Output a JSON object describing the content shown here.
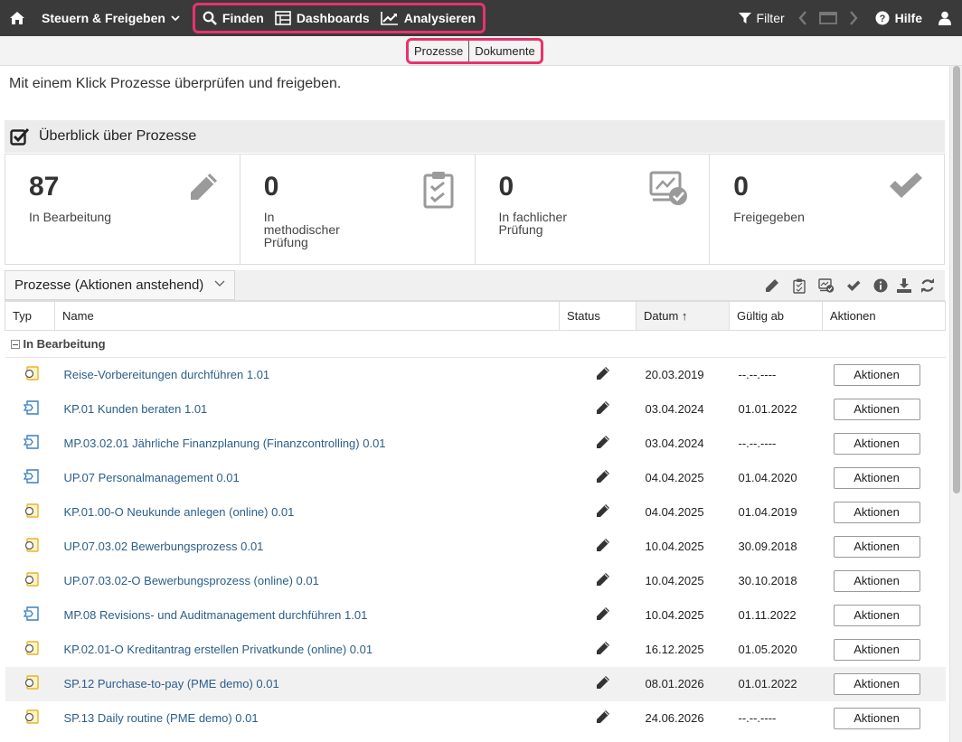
{
  "topbar": {
    "module": "Steuern & Freigeben",
    "finden": "Finden",
    "dashboards": "Dashboards",
    "analysieren": "Analysieren",
    "filter": "Filter",
    "hilfe": "Hilfe"
  },
  "subtabs": [
    "Prozesse",
    "Dokumente"
  ],
  "intro": "Mit einem Klick Prozesse überprüfen und freigeben.",
  "overview": {
    "title": "Überblick über Prozesse",
    "tiles": [
      {
        "count": "87",
        "line1": "In Bearbeitung",
        "line2": "",
        "line3": "",
        "icon": "pencil-icon"
      },
      {
        "count": "0",
        "line1": "In",
        "line2": "methodischer",
        "line3": "Prüfung",
        "icon": "clipboard-check-icon"
      },
      {
        "count": "0",
        "line1": "In fachlicher",
        "line2": "Prüfung",
        "line3": "",
        "icon": "monitor-check-icon"
      },
      {
        "count": "0",
        "line1": "Freigegeben",
        "line2": "",
        "line3": "",
        "icon": "checkmark-icon"
      }
    ]
  },
  "list": {
    "view": "Prozesse (Aktionen anstehend)",
    "columns": {
      "typ": "Typ",
      "name": "Name",
      "status": "Status",
      "datum": "Datum ↑",
      "gueltig": "Gültig ab",
      "aktionen": "Aktionen"
    },
    "group": "In Bearbeitung",
    "rows": [
      {
        "type": "epc",
        "name": "Reise-Vorbereitungen durchführen 1.01",
        "date": "20.03.2019",
        "valid": "--.--.----",
        "action": "Aktionen"
      },
      {
        "type": "vc",
        "name": "KP.01 Kunden beraten 1.01",
        "date": "03.04.2024",
        "valid": "01.01.2022",
        "action": "Aktionen"
      },
      {
        "type": "vc",
        "name": "MP.03.02.01 Jährliche Finanzplanung (Finanzcontrolling) 0.01",
        "date": "03.04.2024",
        "valid": "--.--.----",
        "action": "Aktionen"
      },
      {
        "type": "vc",
        "name": "UP.07 Personalmanagement 0.01",
        "date": "04.04.2025",
        "valid": "01.04.2020",
        "action": "Aktionen"
      },
      {
        "type": "epc",
        "name": "KP.01.00-O Neukunde anlegen (online) 0.01",
        "date": "04.04.2025",
        "valid": "01.04.2019",
        "action": "Aktionen"
      },
      {
        "type": "epc",
        "name": "UP.07.03.02 Bewerbungsprozess 0.01",
        "date": "10.04.2025",
        "valid": "30.09.2018",
        "action": "Aktionen"
      },
      {
        "type": "epc",
        "name": "UP.07.03.02-O Bewerbungsprozess (online) 0.01",
        "date": "10.04.2025",
        "valid": "30.10.2018",
        "action": "Aktionen"
      },
      {
        "type": "vc",
        "name": "MP.08 Revisions- und Auditmanagement durchführen 1.01",
        "date": "10.04.2025",
        "valid": "01.11.2022",
        "action": "Aktionen"
      },
      {
        "type": "epc",
        "name": "KP.02.01-O Kreditantrag erstellen Privatkunde (online) 0.01",
        "date": "16.12.2025",
        "valid": "01.05.2020",
        "action": "Aktionen"
      },
      {
        "type": "epc",
        "name": "SP.12 Purchase-to-pay (PME demo) 0.01",
        "date": "08.01.2026",
        "valid": "01.01.2022",
        "action": "Aktionen"
      },
      {
        "type": "epc",
        "name": "SP.13 Daily routine (PME demo) 0.01",
        "date": "24.06.2026",
        "valid": "--.--.----",
        "action": "Aktionen"
      }
    ]
  },
  "colors": {
    "accent": "#e8336d",
    "topbar": "#3a3a3a",
    "link": "#2b5e8a",
    "epc_icon": "#e5b52a",
    "vc_icon": "#3a7fc1"
  }
}
